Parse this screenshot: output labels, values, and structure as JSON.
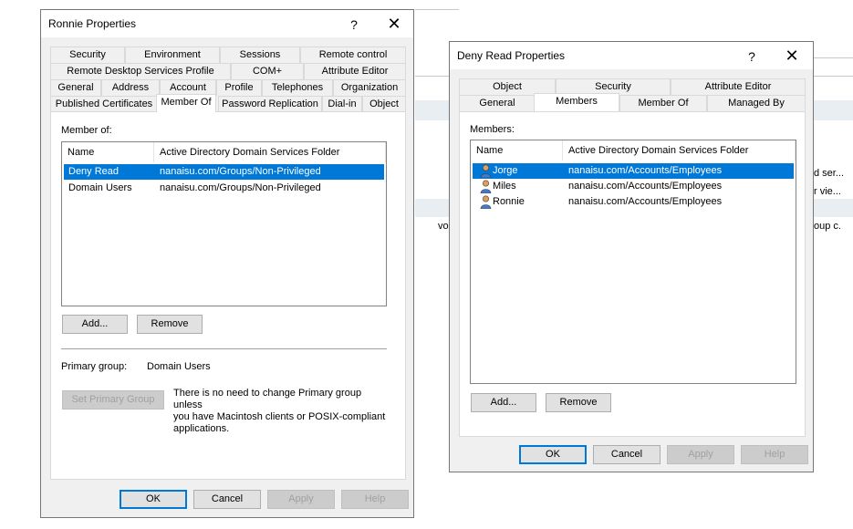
{
  "background": {
    "frag1": "d ser...",
    "frag2": "r vie...",
    "frag3": "vo",
    "frag4": "oup c."
  },
  "ronnie_dialog": {
    "title": "Ronnie Properties",
    "help_glyph": "?",
    "close_glyph": "✕",
    "tabs_row1": [
      "Security",
      "Environment",
      "Sessions",
      "Remote control"
    ],
    "tabs_row2": [
      "Remote Desktop Services Profile",
      "COM+",
      "Attribute Editor"
    ],
    "tabs_row3": [
      "General",
      "Address",
      "Account",
      "Profile",
      "Telephones",
      "Organization"
    ],
    "tabs_row4": [
      "Published Certificates",
      "Member Of",
      "Password Replication",
      "Dial-in",
      "Object"
    ],
    "member_of_label": "Member of:",
    "columns": [
      "Name",
      "Active Directory Domain Services Folder"
    ],
    "rows": [
      {
        "name": "Deny Read",
        "folder": "nanaisu.com/Groups/Non-Privileged"
      },
      {
        "name": "Domain Users",
        "folder": "nanaisu.com/Groups/Non-Privileged"
      }
    ],
    "add_label": "Add...",
    "remove_label": "Remove",
    "primary_group_label": "Primary group:",
    "primary_group_value": "Domain Users",
    "set_primary_label": "Set Primary Group",
    "note_line1": "There is no need to change Primary group unless",
    "note_line2": "you have Macintosh clients or POSIX-compliant",
    "note_line3": "applications.",
    "ok_label": "OK",
    "cancel_label": "Cancel",
    "apply_label": "Apply",
    "help_label": "Help"
  },
  "deny_dialog": {
    "title": "Deny Read Properties",
    "help_glyph": "?",
    "close_glyph": "✕",
    "tabs_row1": [
      "Object",
      "Security",
      "Attribute Editor"
    ],
    "tabs_row2": [
      "General",
      "Members",
      "Member Of",
      "Managed By"
    ],
    "members_label": "Members:",
    "columns": [
      "Name",
      "Active Directory Domain Services Folder"
    ],
    "rows": [
      {
        "name": "Jorge",
        "folder": "nanaisu.com/Accounts/Employees"
      },
      {
        "name": "Miles",
        "folder": "nanaisu.com/Accounts/Employees"
      },
      {
        "name": "Ronnie",
        "folder": "nanaisu.com/Accounts/Employees"
      }
    ],
    "add_label": "Add...",
    "remove_label": "Remove",
    "ok_label": "OK",
    "cancel_label": "Cancel",
    "apply_label": "Apply",
    "help_label": "Help"
  },
  "colors": {
    "selection": "#0078d7",
    "dialog_bg": "#f0f0f0",
    "default_button_border": "#0078d7"
  }
}
